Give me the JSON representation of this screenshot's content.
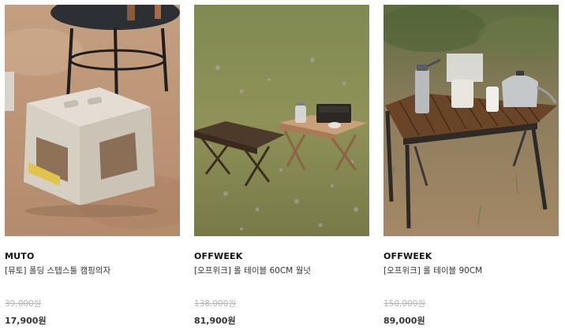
{
  "products": [
    {
      "brand": "MUTO",
      "name": "[뮤토] 폴딩 스텝스툴 캠핑의자",
      "original_price": "39,000원",
      "sale_price": "17,900원",
      "image": "folding-step-stool-on-sand"
    },
    {
      "brand": "OFFWEEK",
      "name": "[오프위크] 롤 테이블 60CM 월넛",
      "original_price": "138,000원",
      "sale_price": "81,900원",
      "image": "walnut-roll-tables-on-grass"
    },
    {
      "brand": "OFFWEEK",
      "name": "[오프위크] 롤 테이블 90CM",
      "original_price": "150,000원",
      "sale_price": "89,000원",
      "image": "roll-table-with-coffee-set"
    }
  ]
}
